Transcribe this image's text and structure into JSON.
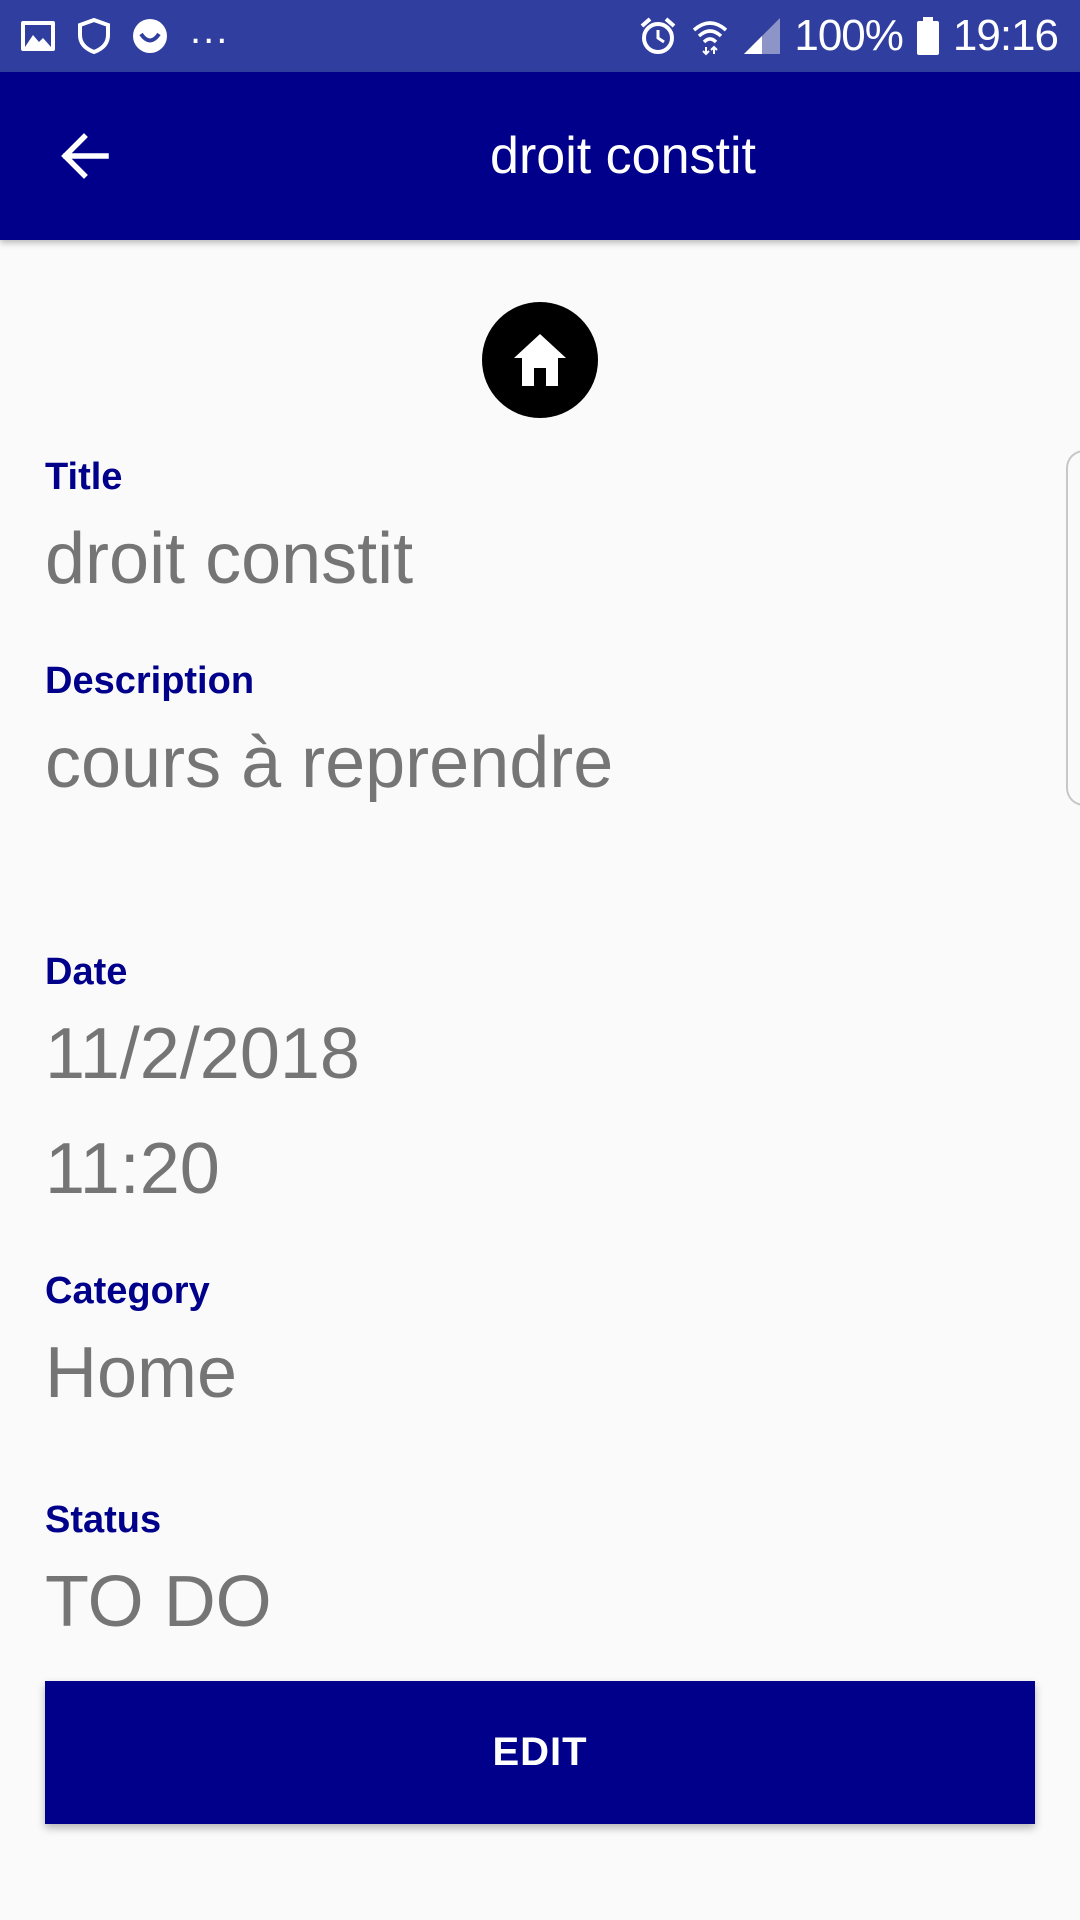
{
  "status_bar": {
    "notification_icons": [
      "image-icon",
      "shield-icon",
      "face-icon"
    ],
    "overflow": "...",
    "system_icons": [
      "alarm-icon",
      "wifi-icon",
      "signal-icon",
      "battery-icon"
    ],
    "battery": "100%",
    "time": "19:16"
  },
  "app_bar": {
    "title": "droit constit",
    "back_icon": "arrow-back-icon"
  },
  "category_icon": "home-icon",
  "fields": {
    "title_label": "Title",
    "title_value": "droit constit",
    "description_label": "Description",
    "description_value": "cours à reprendre",
    "date_label": "Date",
    "date_value": "11/2/2018",
    "time_value": "11:20",
    "category_label": "Category",
    "category_value": "Home",
    "status_label": "Status",
    "status_value": "TO DO"
  },
  "actions": {
    "edit_label": "EDIT"
  },
  "colors": {
    "status_bar": "#303f9f",
    "primary": "#00008b",
    "label": "#00008b",
    "value": "#757575",
    "background": "#fafafa"
  }
}
